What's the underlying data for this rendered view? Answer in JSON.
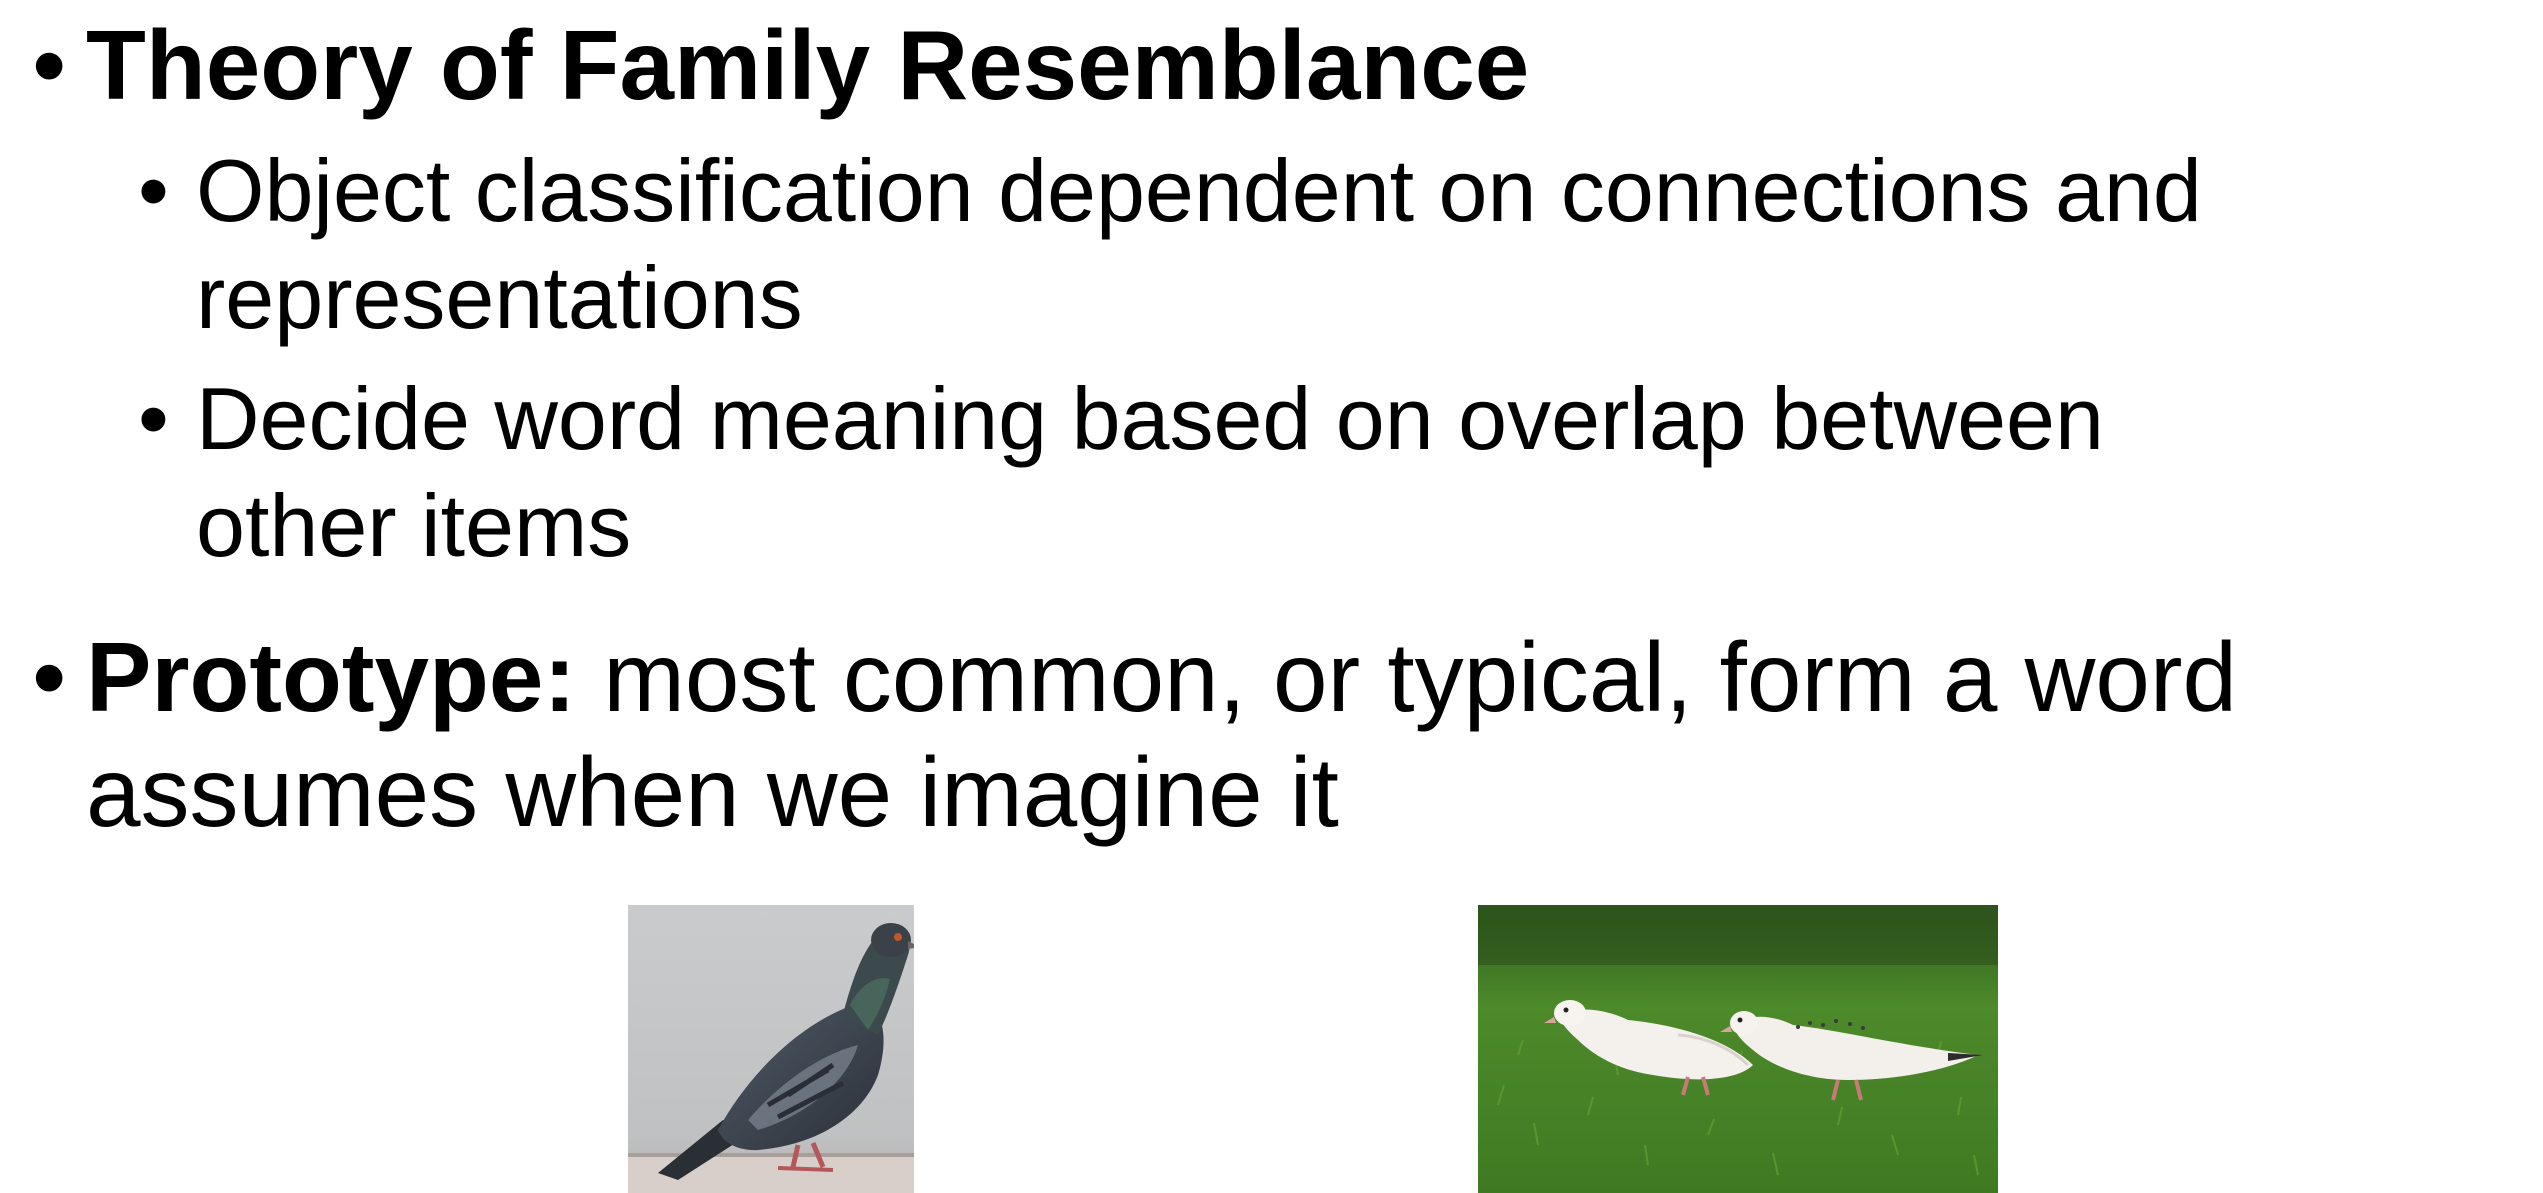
{
  "slide": {
    "bullets": [
      {
        "level": 1,
        "bold_text": "Theory of Family Resemblance",
        "normal_text": "",
        "lines": [
          "Theory of Family Resemblance"
        ]
      },
      {
        "level": 2,
        "lines": [
          "Object classification dependent on connections and",
          "representations"
        ]
      },
      {
        "level": 2,
        "lines": [
          "Decide word meaning based on overlap between",
          "other items"
        ]
      },
      {
        "level": 1,
        "bold_text": "Prototype:",
        "normal_text": " most common, or typical, form a word",
        "continuation": "assumes when we imagine it"
      }
    ],
    "bullet_glyph": "•"
  },
  "images": {
    "pigeon": {
      "icon": "pigeon-photo"
    },
    "doves": {
      "icon": "white-doves-photo"
    }
  },
  "colors": {
    "text": "#000000",
    "background": "#ffffff"
  }
}
